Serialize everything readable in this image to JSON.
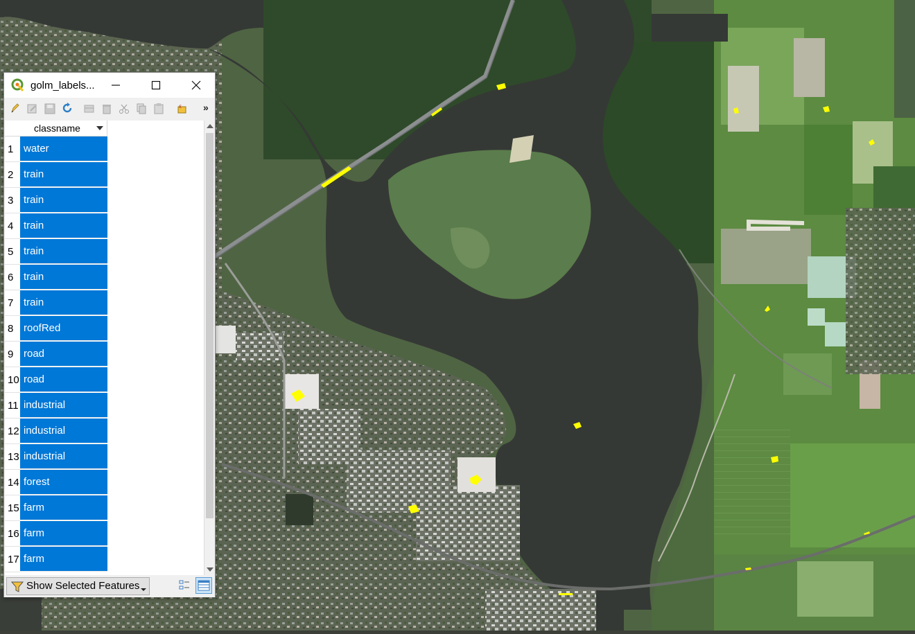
{
  "window": {
    "title": "golm_labels...",
    "minimize": "—",
    "maximize": "□",
    "close": "✕"
  },
  "toolbar": {
    "more": "»",
    "tools": [
      "pencil-icon",
      "multi-edit-icon",
      "save-icon",
      "reload-icon",
      "add-feature-icon",
      "delete-icon",
      "cut-icon",
      "copy-icon",
      "paste-icon",
      "expression-select-icon"
    ]
  },
  "table": {
    "column": "classname",
    "rows": [
      {
        "n": "1",
        "v": "water"
      },
      {
        "n": "2",
        "v": "train"
      },
      {
        "n": "3",
        "v": "train"
      },
      {
        "n": "4",
        "v": "train"
      },
      {
        "n": "5",
        "v": "train"
      },
      {
        "n": "6",
        "v": "train"
      },
      {
        "n": "7",
        "v": "train"
      },
      {
        "n": "8",
        "v": "roofRed"
      },
      {
        "n": "9",
        "v": "road"
      },
      {
        "n": "10",
        "v": "road"
      },
      {
        "n": "11",
        "v": "industrial"
      },
      {
        "n": "12",
        "v": "industrial"
      },
      {
        "n": "13",
        "v": "industrial"
      },
      {
        "n": "14",
        "v": "forest"
      },
      {
        "n": "15",
        "v": "farm"
      },
      {
        "n": "16",
        "v": "farm"
      },
      {
        "n": "17",
        "v": "farm"
      }
    ]
  },
  "bottombar": {
    "filter_label": "Show Selected Features"
  },
  "colors": {
    "selection": "#0078d7",
    "feature_highlight": "#ffff00",
    "water": "#353935"
  }
}
